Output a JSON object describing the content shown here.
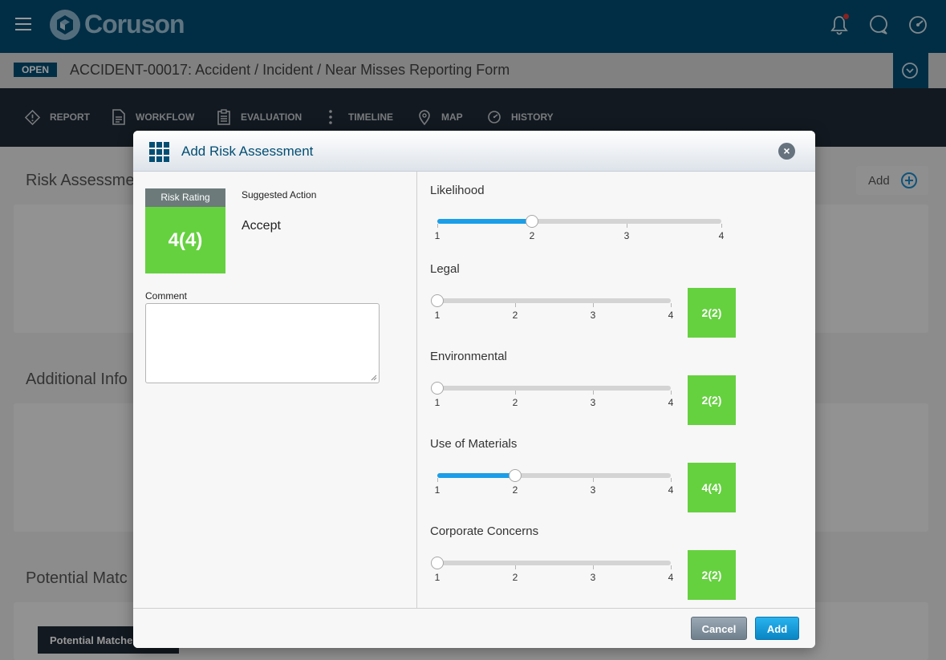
{
  "app": {
    "brand": "Coruson"
  },
  "record": {
    "status": "OPEN",
    "title": "ACCIDENT-00017: Accident / Incident / Near Misses Reporting Form"
  },
  "nav": {
    "items": [
      {
        "label": "REPORT",
        "icon": "report-icon"
      },
      {
        "label": "WORKFLOW",
        "icon": "document-icon"
      },
      {
        "label": "EVALUATION",
        "icon": "clipboard-icon"
      },
      {
        "label": "TIMELINE",
        "icon": "vertical-dots-icon"
      },
      {
        "label": "MAP",
        "icon": "map-pin-icon"
      },
      {
        "label": "HISTORY",
        "icon": "history-icon"
      }
    ]
  },
  "background": {
    "sections": [
      "Risk Assessme",
      "Additional Info",
      "Potential Matc"
    ],
    "add_label": "Add",
    "potential_button": "Potential Matche"
  },
  "modal": {
    "title": "Add Risk Assessment",
    "risk_rating_label": "Risk Rating",
    "risk_rating_value": "4(4)",
    "risk_rating_color": "#65d13f",
    "suggested_action_label": "Suggested Action",
    "suggested_action_value": "Accept",
    "comment_label": "Comment",
    "comment_value": "",
    "factors": [
      {
        "label": "Likelihood",
        "value": 2,
        "min": 1,
        "max": 4,
        "ticks": [
          "1",
          "2",
          "3",
          "4"
        ],
        "badge": null
      },
      {
        "label": "Legal",
        "value": 1,
        "min": 1,
        "max": 4,
        "ticks": [
          "1",
          "2",
          "3",
          "4"
        ],
        "badge": "2(2)"
      },
      {
        "label": "Environmental",
        "value": 1,
        "min": 1,
        "max": 4,
        "ticks": [
          "1",
          "2",
          "3",
          "4"
        ],
        "badge": "2(2)"
      },
      {
        "label": "Use of Materials",
        "value": 2,
        "min": 1,
        "max": 4,
        "ticks": [
          "1",
          "2",
          "3",
          "4"
        ],
        "badge": "4(4)"
      },
      {
        "label": "Corporate Concerns",
        "value": 1,
        "min": 1,
        "max": 4,
        "ticks": [
          "1",
          "2",
          "3",
          "4"
        ],
        "badge": "2(2)"
      }
    ],
    "cancel_label": "Cancel",
    "add_label": "Add"
  }
}
